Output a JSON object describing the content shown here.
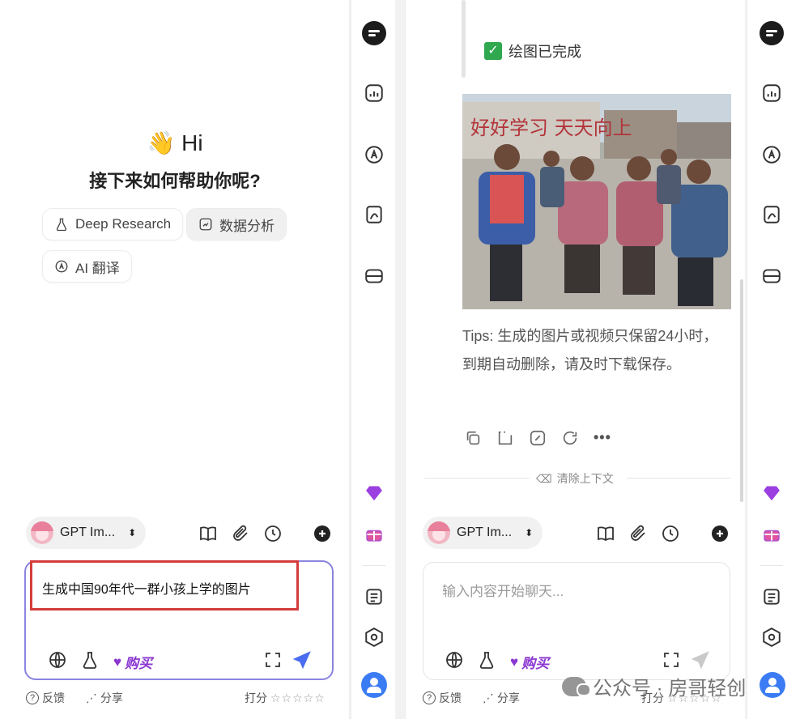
{
  "left": {
    "greeting_emoji": "👋",
    "greeting": "Hi",
    "subtitle": "接下来如何帮助你呢?",
    "chips": [
      {
        "label": "Deep Research",
        "icon": "flask-icon"
      },
      {
        "label": "数据分析",
        "icon": "chart-icon"
      },
      {
        "label": "AI 翻译",
        "icon": "translate-icon"
      }
    ],
    "model": "GPT Im...",
    "prompt": "生成中国90年代一群小孩上学的图片",
    "buy_label": "购买",
    "feedback": "反馈",
    "share": "分享",
    "rating_label": "打分",
    "stars": "☆☆☆☆☆"
  },
  "right": {
    "status": "绘图已完成",
    "check": "✓",
    "image_sign_text": "好好学习 天天向上",
    "tips": "Tips: 生成的图片或视频只保留24小时，到期自动删除，请及时下载保存。",
    "more": "•••",
    "clear_context": "清除上下文",
    "model": "GPT Im...",
    "placeholder": "输入内容开始聊天...",
    "buy_label": "购买",
    "feedback": "反馈",
    "share": "分享",
    "rating_label": "打分",
    "stars": "☆☆☆☆☆"
  },
  "watermark": "公众号 · 房哥轻创",
  "colors": {
    "accent": "#8b84e0",
    "highlight": "#d43c3c",
    "buy": "#8a36d1",
    "check": "#2fa84f"
  }
}
